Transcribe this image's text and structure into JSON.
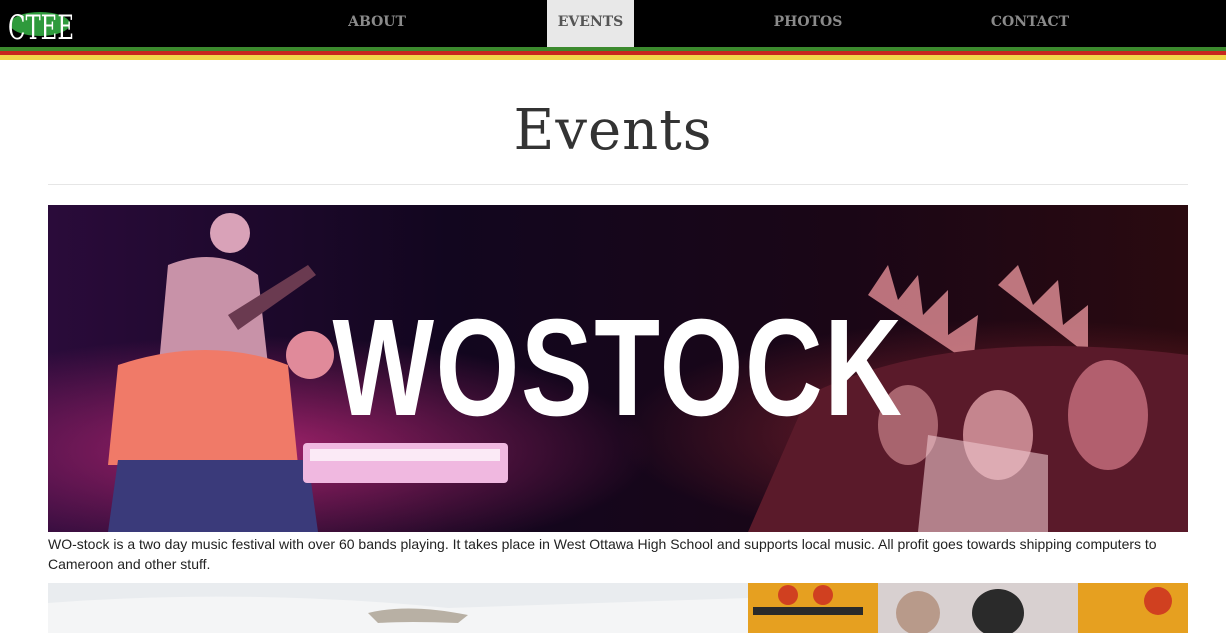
{
  "nav": {
    "logo_text": "CTEE",
    "items": [
      {
        "label": "ABOUT",
        "active": false
      },
      {
        "label": "EVENTS",
        "active": true
      },
      {
        "label": "PHOTOS",
        "active": false
      },
      {
        "label": "CONTACT",
        "active": false
      }
    ]
  },
  "colors": {
    "stripe_green": "#3c8a2e",
    "stripe_red": "#c8281e",
    "stripe_yellow": "#f2d64a",
    "logo_green": "#2e9a3c"
  },
  "page": {
    "title": "Events"
  },
  "events": [
    {
      "title": "WOSTOCK",
      "description": "WO-stock is a two day music festival with over 60 bands playing. It takes place in West Ottawa High School and supports local music. All profit goes towards shipping computers to Cameroon and other stuff."
    }
  ]
}
